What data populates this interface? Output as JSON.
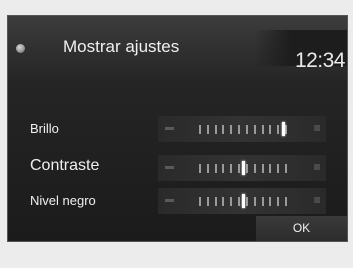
{
  "header": {
    "title": "Mostrar ajustes",
    "clock": "12:34",
    "app_icon": "settings-dot-icon"
  },
  "settings": [
    {
      "label": "Brillo",
      "level": 0.95,
      "tick_count": 12
    },
    {
      "label": "Contraste",
      "level": 0.5,
      "tick_count": 12
    },
    {
      "label": "Nivel negro",
      "level": 0.5,
      "tick_count": 12
    }
  ],
  "ok_button": {
    "label": "OK"
  },
  "colors": {
    "background": "#1e1e1e",
    "text": "#f0f0f0",
    "marker": "#ffffff"
  }
}
